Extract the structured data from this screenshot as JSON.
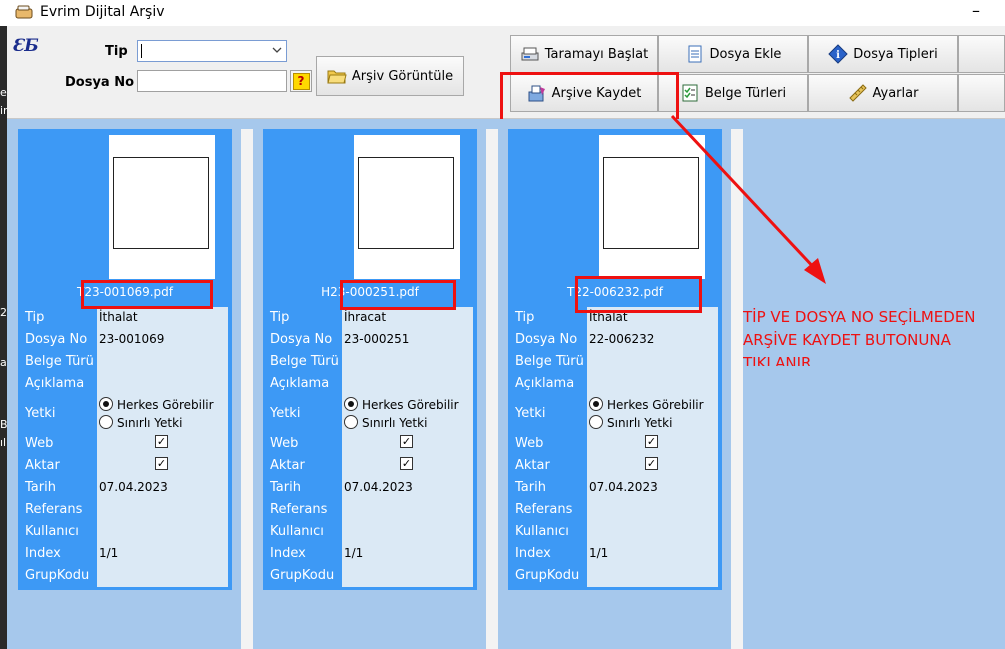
{
  "window": {
    "title": "Evrim Dijital Arşiv",
    "minimize_glyph": "–",
    "app_icon": "hand-icon",
    "logo": "ƐƂ"
  },
  "left_strip_fragments": [
    "e",
    "ir",
    "2",
    "a",
    "B",
    "ıl"
  ],
  "form": {
    "tip_label": "Tip",
    "dosya_no_label": "Dosya No",
    "tip_value": "",
    "dosya_no_value": "",
    "help_button_label": "?",
    "arsiv_goruntule_label": "Arşiv Görüntüle"
  },
  "toolbar": {
    "taramayi_baslat": "Taramayı Başlat",
    "dosya_ekle": "Dosya Ekle",
    "dosya_tipleri": "Dosya Tipleri",
    "arsive_kaydet": "Arşive Kaydet",
    "belge_turleri": "Belge Türleri",
    "ayarlar": "Ayarlar"
  },
  "field_labels": {
    "tip": "Tip",
    "dosya_no": "Dosya No",
    "belge_turu": "Belge Türü",
    "aciklama": "Açıklama",
    "yetki": "Yetki",
    "web": "Web",
    "aktar": "Aktar",
    "tarih": "Tarih",
    "referans": "Referans",
    "kullanici": "Kullanıcı",
    "index": "Index",
    "grup_kodu": "GrupKodu"
  },
  "yetki_options": [
    "Herkes Görebilir",
    "Sınırlı Yetki"
  ],
  "documents": [
    {
      "filename": "T23-001069.pdf",
      "tip": "İthalat",
      "dosya_no": "23-001069",
      "yetki_selected": "Herkes Görebilir",
      "web": true,
      "aktar": true,
      "tarih": "07.04.2023",
      "index": "1/1"
    },
    {
      "filename": "H23-000251.pdf",
      "tip": "İhracat",
      "dosya_no": "23-000251",
      "yetki_selected": "Herkes Görebilir",
      "web": true,
      "aktar": true,
      "tarih": "07.04.2023",
      "index": "1/1"
    },
    {
      "filename": "T22-006232.pdf",
      "tip": "İthalat",
      "dosya_no": "22-006232",
      "yetki_selected": "Herkes Görebilir",
      "web": true,
      "aktar": true,
      "tarih": "07.04.2023",
      "index": "1/1"
    }
  ],
  "annotation": {
    "lines": [
      "TİP VE DOSYA NO SEÇİLMEDEN",
      "ARŞİVE KAYDET BUTONUNA",
      "TIKLANIR"
    ],
    "color": "#ee1111"
  },
  "colors": {
    "panel_blue": "#3d99f5",
    "fields_bg": "#dbe9f5",
    "area_bg": "#a6c8ec"
  }
}
